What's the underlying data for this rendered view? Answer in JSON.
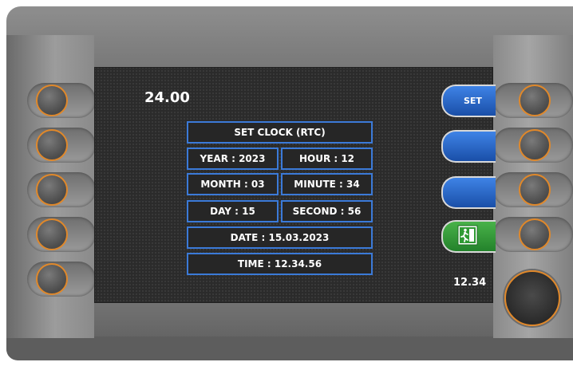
{
  "screen": {
    "top_value": "24.00",
    "bottom_value": "12.34",
    "panel_title": "SET CLOCK (RTC)",
    "fields": {
      "year": "YEAR : 2023",
      "hour": "HOUR : 12",
      "month": "MONTH : 03",
      "minute": "MINUTE : 34",
      "day": "DAY : 15",
      "second": "SECOND : 56",
      "date": "DATE : 15.03.2023",
      "time": "TIME : 12.34.56"
    }
  },
  "softkeys": {
    "set_label": "SET",
    "key2_label": "",
    "key3_label": "",
    "exit_icon": "exit-door-icon"
  },
  "colors": {
    "accent_blue": "#3b7ad8",
    "exit_green": "#2f9a33",
    "button_ring": "#e0882a"
  }
}
